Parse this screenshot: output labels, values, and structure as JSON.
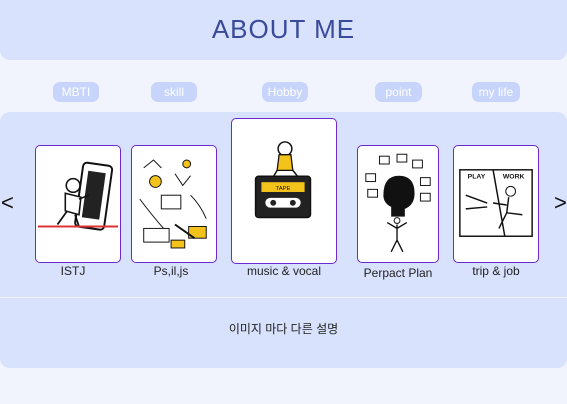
{
  "header": {
    "title": "ABOUT ME"
  },
  "tabs": [
    {
      "label": "MBTI"
    },
    {
      "label": "skill"
    },
    {
      "label": "Hobby"
    },
    {
      "label": "point"
    },
    {
      "label": "my life"
    }
  ],
  "carousel": {
    "prev_label": "<",
    "next_label": ">",
    "cards": [
      {
        "caption": "ISTJ",
        "icon": "person-pushing-phone-illustration"
      },
      {
        "caption": "Ps,il,js",
        "icon": "design-tools-illustration"
      },
      {
        "caption": "music & vocal",
        "icon": "cassette-tape-illustration"
      },
      {
        "caption": "Perpact Plan",
        "icon": "head-with-ideas-illustration"
      },
      {
        "caption": "trip & job",
        "icon": "play-work-illustration"
      }
    ],
    "illustration_text": {
      "play": "PLAY",
      "work": "WORK",
      "tape_label": "TAPE"
    }
  },
  "description": {
    "text": "이미지 마다 다른 설명"
  },
  "colors": {
    "accent": "#6a2ad0",
    "panel": "#d8e2fd",
    "title": "#3a4a9a",
    "tab": "#c7d4fb"
  }
}
